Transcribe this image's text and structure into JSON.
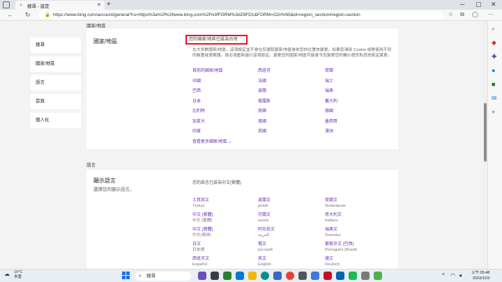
{
  "browser": {
    "tab_title": "搜尋 - 設定",
    "url": "https://www.bing.com/account/general?ru=https%3a%2f%2fwww.bing.com%2f%3fFORM%3dZ9FD1&FORM=O2HV65&id=region_section#region-section"
  },
  "sidebar": {
    "items": [
      "搜尋",
      "國家/地區",
      "語言",
      "首頁",
      "個人化"
    ]
  },
  "region": {
    "section_label": "國家/地區",
    "title": "國家/地區",
    "current": "您的國家/地區已設為台灣",
    "description": "在大多數國家/地區，這項設定並不會在您選取國家/地區後依您的位置來變更。如果您清除 Cookie 或是使用不同的裝置或瀏覽器，就必須重新進行這項設定。變更您的國家/地區可能會令您變更您的顯示語言和其他設定變更。",
    "countries": [
      "目前的國家/地區",
      "西班牙",
      "荷蘭",
      "中國",
      "法國",
      "瑞士",
      "巴西",
      "波蘭",
      "瑞典",
      "日本",
      "俄羅斯",
      "義大利",
      "比利時",
      "南韓",
      "德國",
      "加拿大",
      "美國",
      "墨西哥",
      "印度",
      "英國",
      "澳洲"
    ],
    "more_label": "查看更多國家/地區"
  },
  "language": {
    "section_label": "語言",
    "title": "顯示語言",
    "subtitle": "選擇您的顯示語言。",
    "current": "您的語言已設為中文(繁體)",
    "languages": [
      {
        "name": "土耳其文",
        "native": "Türkçe"
      },
      {
        "name": "波蘭文",
        "native": "polski"
      },
      {
        "name": "荷蘭文",
        "native": "Nederlands"
      },
      {
        "name": "中文 (繁體)",
        "native": "中文 (繁體)"
      },
      {
        "name": "芬蘭文",
        "native": "suomi"
      },
      {
        "name": "意大利文",
        "native": "Italiano"
      },
      {
        "name": "中文 (簡體)",
        "native": "中文(简体)"
      },
      {
        "name": "阿拉伯文",
        "native": "العربية"
      },
      {
        "name": "瑞典文",
        "native": "Svenska"
      },
      {
        "name": "日文",
        "native": "日本語"
      },
      {
        "name": "俄文",
        "native": "русский"
      },
      {
        "name": "葡萄牙文 (巴西)",
        "native": "Português (Brasil)"
      },
      {
        "name": "西班牙文",
        "native": "Español"
      },
      {
        "name": "英文",
        "native": "English"
      },
      {
        "name": "德文",
        "native": "Deutsch"
      },
      {
        "name": "法文",
        "native": ""
      },
      {
        "name": "捷克文",
        "native": ""
      },
      {
        "name": "韓文",
        "native": ""
      }
    ]
  },
  "taskbar": {
    "weather_temp": "19°C",
    "weather_desc": "多雲",
    "search_placeholder": "搜尋",
    "time": "上午 05:48",
    "date": "2023/12/3"
  },
  "colors": {
    "link": "#6b2fb3",
    "highlight_border": "#e81123",
    "scroll_thumb": "#8a8a8a"
  }
}
